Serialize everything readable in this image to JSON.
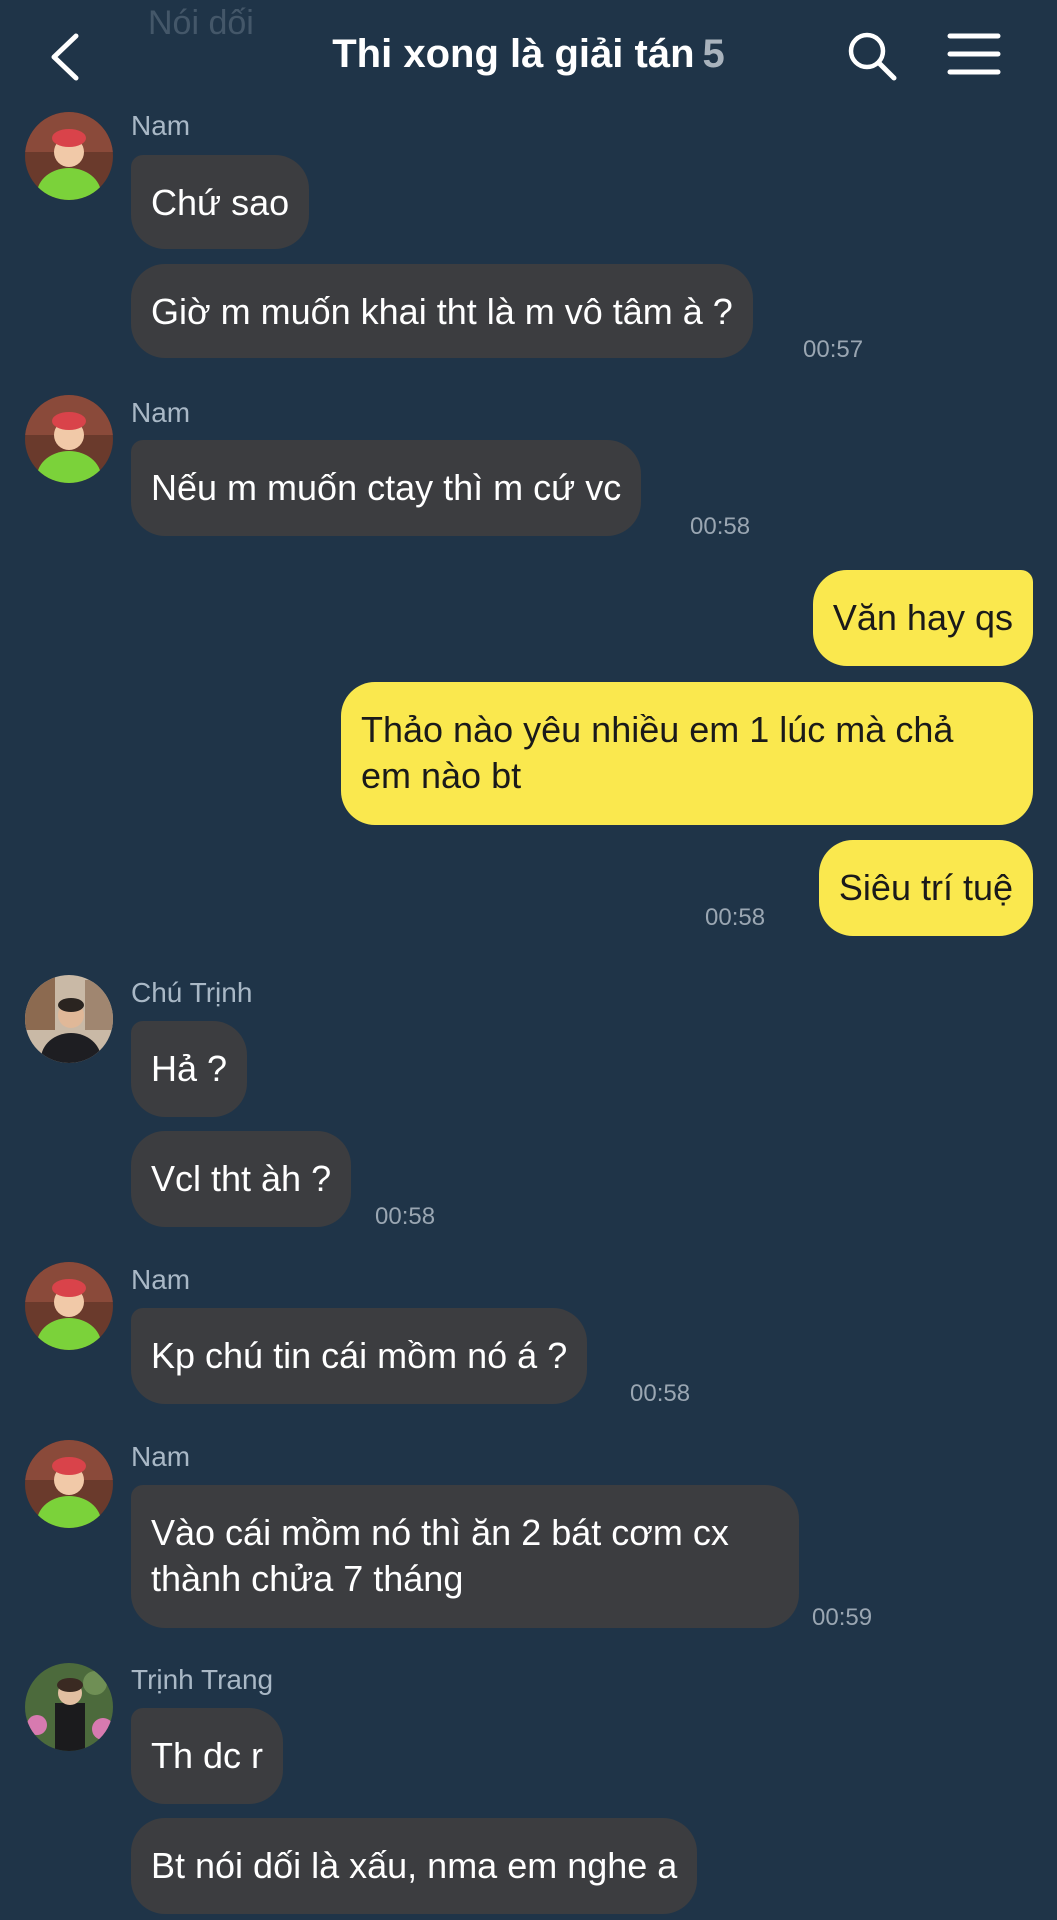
{
  "header": {
    "faded_preview": "Nói dối",
    "title": "Thi xong là giải tán",
    "member_count": "5",
    "icons": [
      "back-arrow-icon",
      "search-icon",
      "menu-icon"
    ]
  },
  "messages": [
    {
      "sender": "Nam",
      "texts": [
        "Chứ sao",
        "Giờ m muốn khai tht là m vô tâm à ?"
      ],
      "time": "00:57"
    },
    {
      "sender": "Nam",
      "texts": [
        "Nếu m muốn ctay thì m cứ vc"
      ],
      "time": "00:58"
    },
    {
      "sender": "me",
      "texts": [
        "Văn hay qs",
        "Thảo nào yêu nhiều em 1 lúc mà chả em nào bt",
        "Siêu trí tuệ"
      ],
      "lines": [
        "Thảo nào yêu nhiều em 1 lúc mà chả",
        "em nào bt"
      ],
      "time": "00:58"
    },
    {
      "sender": "Chú Trịnh",
      "texts": [
        "Hả ?",
        "Vcl tht àh ?"
      ],
      "time": "00:58"
    },
    {
      "sender": "Nam",
      "texts": [
        "Kp chú tin cái mồm nó á ?"
      ],
      "time": "00:58"
    },
    {
      "sender": "Nam",
      "texts": [
        "Vào cái mồm nó thì ăn 2 bát cơm cx thành chửa 7 tháng"
      ],
      "lines": [
        "Vào cái mồm nó thì ăn 2 bát cơm cx",
        "thành chửa 7 tháng"
      ],
      "time": "00:59"
    },
    {
      "sender": "Trịnh Trang",
      "texts": [
        "Th dc r",
        "Bt nói dối là xấu, nma em nghe a"
      ]
    }
  ],
  "colors": {
    "background": "#1f3448",
    "incoming_bubble": "#3c3d40",
    "outgoing_bubble": "#fae84e",
    "sender_name": "#a9b8c6",
    "timestamp": "#9aa6b2"
  }
}
